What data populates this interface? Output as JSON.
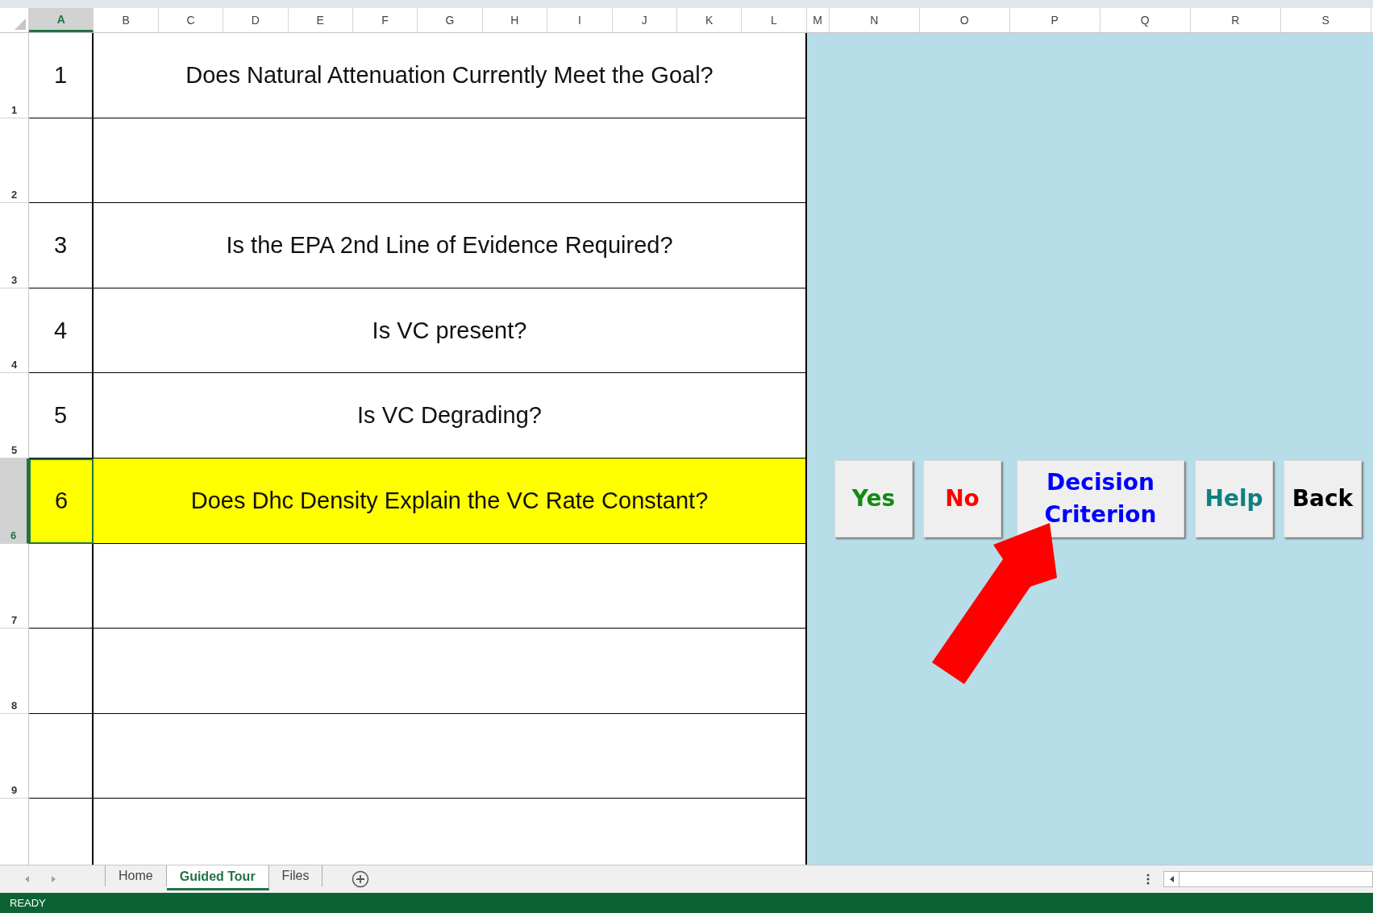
{
  "columns": [
    {
      "label": "A",
      "selected": true
    },
    {
      "label": "B",
      "selected": false
    },
    {
      "label": "C",
      "selected": false
    },
    {
      "label": "D",
      "selected": false
    },
    {
      "label": "E",
      "selected": false
    },
    {
      "label": "F",
      "selected": false
    },
    {
      "label": "G",
      "selected": false
    },
    {
      "label": "H",
      "selected": false
    },
    {
      "label": "I",
      "selected": false
    },
    {
      "label": "J",
      "selected": false
    },
    {
      "label": "K",
      "selected": false
    },
    {
      "label": "L",
      "selected": false
    },
    {
      "label": "M",
      "selected": false
    },
    {
      "label": "N",
      "selected": false
    },
    {
      "label": "O",
      "selected": false
    },
    {
      "label": "P",
      "selected": false
    },
    {
      "label": "Q",
      "selected": false
    },
    {
      "label": "R",
      "selected": false
    },
    {
      "label": "S",
      "selected": false
    }
  ],
  "rows": [
    {
      "header": "1",
      "number": "1",
      "question": "Does Natural Attenuation Currently Meet the Goal?",
      "selected": false
    },
    {
      "header": "2",
      "selected": false
    },
    {
      "header": "3",
      "number": "3",
      "question": "Is the EPA 2nd Line of Evidence Required?",
      "selected": false
    },
    {
      "header": "4",
      "number": "4",
      "question": "Is VC present?",
      "selected": false
    },
    {
      "header": "5",
      "number": "5",
      "question": "Is VC Degrading?",
      "selected": false
    },
    {
      "header": "6",
      "number": "6",
      "question": "Does Dhc Density Explain the VC Rate Constant?",
      "selected": true
    },
    {
      "header": "7",
      "selected": false
    },
    {
      "header": "8",
      "selected": false
    },
    {
      "header": "9",
      "selected": false
    }
  ],
  "buttons": [
    {
      "label": "Yes",
      "color": "#138a13"
    },
    {
      "label": "No",
      "color": "#ff0000"
    },
    {
      "label": "Decision Criterion",
      "color": "#0000ff"
    },
    {
      "label": "Help",
      "color": "#0f8080"
    },
    {
      "label": "Back",
      "color": "#000000"
    }
  ],
  "sheet_tabs": [
    {
      "label": "Home",
      "selected": false
    },
    {
      "label": "Guided Tour",
      "selected": true
    },
    {
      "label": "Files",
      "selected": false
    }
  ],
  "status_bar": {
    "mode": "READY"
  }
}
